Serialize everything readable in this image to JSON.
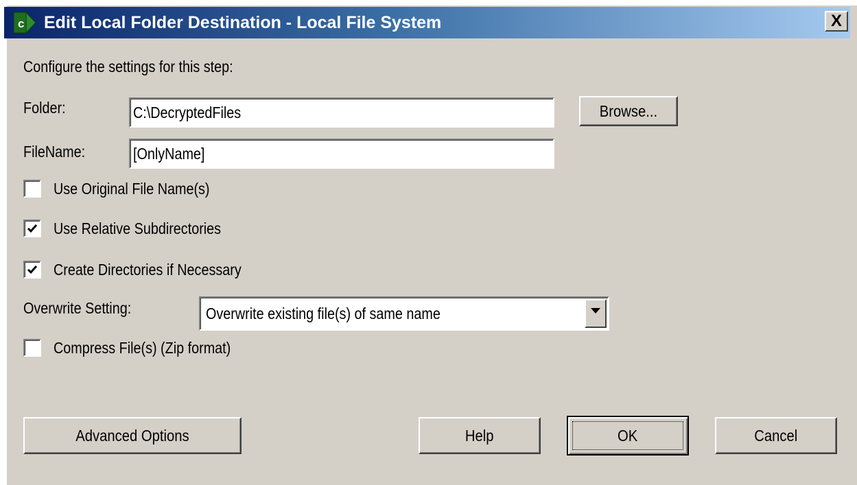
{
  "window": {
    "title": "Edit Local Folder Destination - Local File System",
    "close_label": "X"
  },
  "form": {
    "intro": "Configure the settings for this step:",
    "folder_label": "Folder:",
    "folder_value": "C:\\DecryptedFiles",
    "browse_label": "Browse...",
    "filename_label": "FileName:",
    "filename_value": "[OnlyName]",
    "use_original_label": "Use Original File Name(s)",
    "use_original_checked": false,
    "use_relative_label": "Use Relative Subdirectories",
    "use_relative_checked": true,
    "create_dirs_label": "Create Directories if Necessary",
    "create_dirs_checked": true,
    "overwrite_label": "Overwrite Setting:",
    "overwrite_value": "Overwrite existing file(s) of same name",
    "compress_label": "Compress File(s) (Zip format)",
    "compress_checked": false
  },
  "buttons": {
    "advanced": "Advanced Options",
    "help": "Help",
    "ok": "OK",
    "cancel": "Cancel"
  },
  "icons": {
    "title_icon": "app-arrow-icon",
    "close": "close-icon",
    "check": "check-icon",
    "dropdown": "chevron-down-icon"
  },
  "colors": {
    "dialog_bg": "#d4d0c8",
    "title_start": "#0a246a",
    "title_end": "#a6caf0",
    "icon_green": "#2e8b2e"
  }
}
